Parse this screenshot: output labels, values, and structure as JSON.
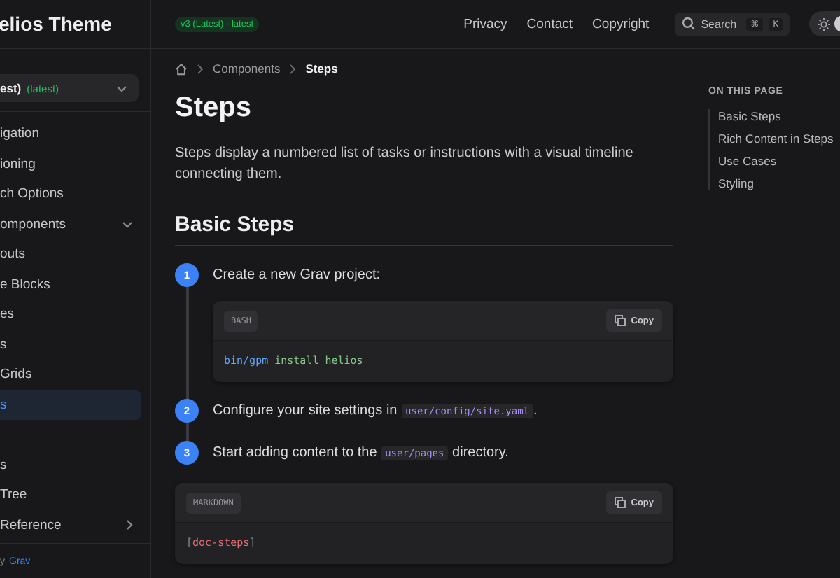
{
  "sidebar": {
    "brand": "elios Theme",
    "version_select": {
      "value": "est)",
      "tag": "(latest)"
    },
    "items": [
      {
        "label": "igation",
        "selected": false
      },
      {
        "label": "ioning",
        "selected": false
      },
      {
        "label": "ch Options",
        "selected": false
      },
      {
        "label": "omponents",
        "selected": false,
        "expanded": true
      },
      {
        "label": "outs",
        "selected": false
      },
      {
        "label": "e Blocks",
        "selected": false
      },
      {
        "label": "es",
        "selected": false
      },
      {
        "label": "s",
        "selected": false
      },
      {
        "label": " Grids",
        "selected": false
      },
      {
        "label": "s",
        "selected": true
      },
      {
        "label": "s",
        "selected": false
      },
      {
        "label": "Tree",
        "selected": false
      },
      {
        "label": "Reference",
        "selected": false,
        "expanded": false
      }
    ],
    "footer": {
      "text": "y",
      "link": "Grav"
    }
  },
  "header": {
    "version_badge": "v3 (Latest) · latest",
    "nav": [
      "Privacy",
      "Contact",
      "Copyright"
    ],
    "search": {
      "placeholder": "Search",
      "keys": [
        "⌘",
        "K"
      ]
    },
    "theme_toggle": {
      "dark": true
    }
  },
  "breadcrumb": [
    "Components",
    "Steps"
  ],
  "title": "Steps",
  "description": "Steps display a numbered list of tasks or instructions with a visual timeline connecting them.",
  "section_heading": "Basic Steps",
  "steps": [
    {
      "number": "1",
      "parts": [
        {
          "kind": "text",
          "text": "Create a new Grav project:"
        }
      ],
      "code_block": {
        "language": "BASH",
        "copy": "Copy",
        "tokens": [
          {
            "kind": "command",
            "text": "bin/gpm"
          },
          {
            "kind": "argument",
            "text": "install helios"
          }
        ]
      }
    },
    {
      "number": "2",
      "parts": [
        {
          "kind": "text",
          "text": "Configure your site settings in"
        },
        {
          "kind": "code",
          "text": "user/config/site.yaml"
        },
        {
          "kind": "text",
          "text": "."
        }
      ]
    },
    {
      "number": "3",
      "parts": [
        {
          "kind": "text",
          "text": "Start adding content to the"
        },
        {
          "kind": "code",
          "text": "user/pages"
        },
        {
          "kind": "text",
          "text": "directory."
        }
      ]
    }
  ],
  "example_block": {
    "language": "MARKDOWN",
    "copy": "Copy",
    "tokens": [
      {
        "kind": "punct",
        "text": "["
      },
      {
        "kind": "tag",
        "text": "doc-steps"
      },
      {
        "kind": "punct",
        "text": "]"
      }
    ]
  },
  "toc": {
    "heading": "ON THIS PAGE",
    "items": [
      "Basic Steps",
      "Rich Content in Steps",
      "Use Cases",
      "Styling"
    ]
  }
}
